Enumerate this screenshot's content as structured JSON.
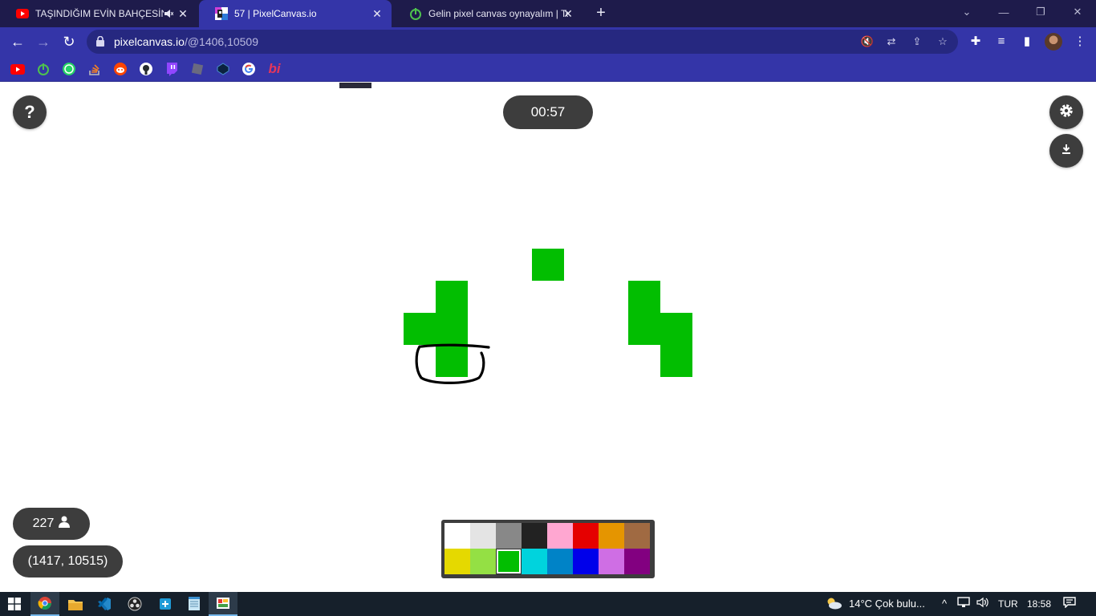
{
  "browser": {
    "tabs": [
      {
        "title": "TAŞINDIĞIM EVİN BAHÇESİN",
        "favicon": "youtube-icon",
        "muted": true
      },
      {
        "title": "57 | PixelCanvas.io",
        "favicon": "pixelcanvas-icon",
        "active": true
      },
      {
        "title": "Gelin pixel canvas oynayalım | Te",
        "favicon": "power-icon"
      }
    ],
    "url_host": "pixelcanvas.io",
    "url_path": "/@1406,10509",
    "bookmarks": [
      "youtube-icon",
      "power-icon",
      "whatsapp-icon",
      "stackoverflow-icon",
      "reddit-icon",
      "github-icon",
      "twitch-icon",
      "roblox-icon",
      "codepen-icon",
      "google-icon",
      "bi-icon"
    ],
    "bookmark_bi_text": "bi"
  },
  "game": {
    "help_label": "?",
    "timer": "00:57",
    "online_count": "227",
    "coordinates": "(1417, 10515)",
    "palette": [
      "#ffffff",
      "#e4e4e4",
      "#888888",
      "#222222",
      "#ffa7d1",
      "#e50000",
      "#e59500",
      "#a06a42",
      "#e5d900",
      "#94e044",
      "#02be01",
      "#00d3dd",
      "#0083c7",
      "#0000ea",
      "#cf6ee4",
      "#820080"
    ],
    "selected_color_index": 10,
    "pixel_color": "#02be01",
    "pixels": [
      {
        "col": 4,
        "row": 0
      },
      {
        "col": 1,
        "row": 1
      },
      {
        "col": 7,
        "row": 1
      },
      {
        "col": 0,
        "row": 2
      },
      {
        "col": 1,
        "row": 2
      },
      {
        "col": 7,
        "row": 2
      },
      {
        "col": 8,
        "row": 2
      },
      {
        "col": 1,
        "row": 3
      },
      {
        "col": 8,
        "row": 3
      }
    ]
  },
  "taskbar": {
    "apps": [
      "windows-start-icon",
      "chrome-icon",
      "file-explorer-icon",
      "vscode-icon",
      "obs-icon",
      "app-icon",
      "notepad-icon",
      "paint-icon"
    ],
    "weather": "14°C  Çok bulu...",
    "language": "TUR",
    "time": "18:58"
  }
}
